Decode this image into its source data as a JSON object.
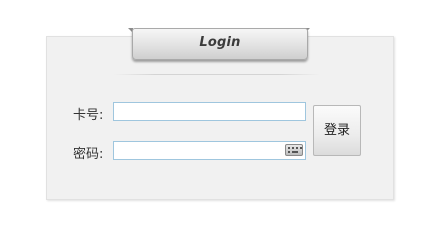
{
  "panel": {
    "title": "Login"
  },
  "form": {
    "card_label": "卡号:",
    "card_value": "",
    "password_label": "密码:",
    "password_value": "",
    "keyboard_icon": "keyboard-icon",
    "submit_label": "登录"
  },
  "colors": {
    "panel_background": "#f1f1f1",
    "input_border": "#9fc6de"
  }
}
